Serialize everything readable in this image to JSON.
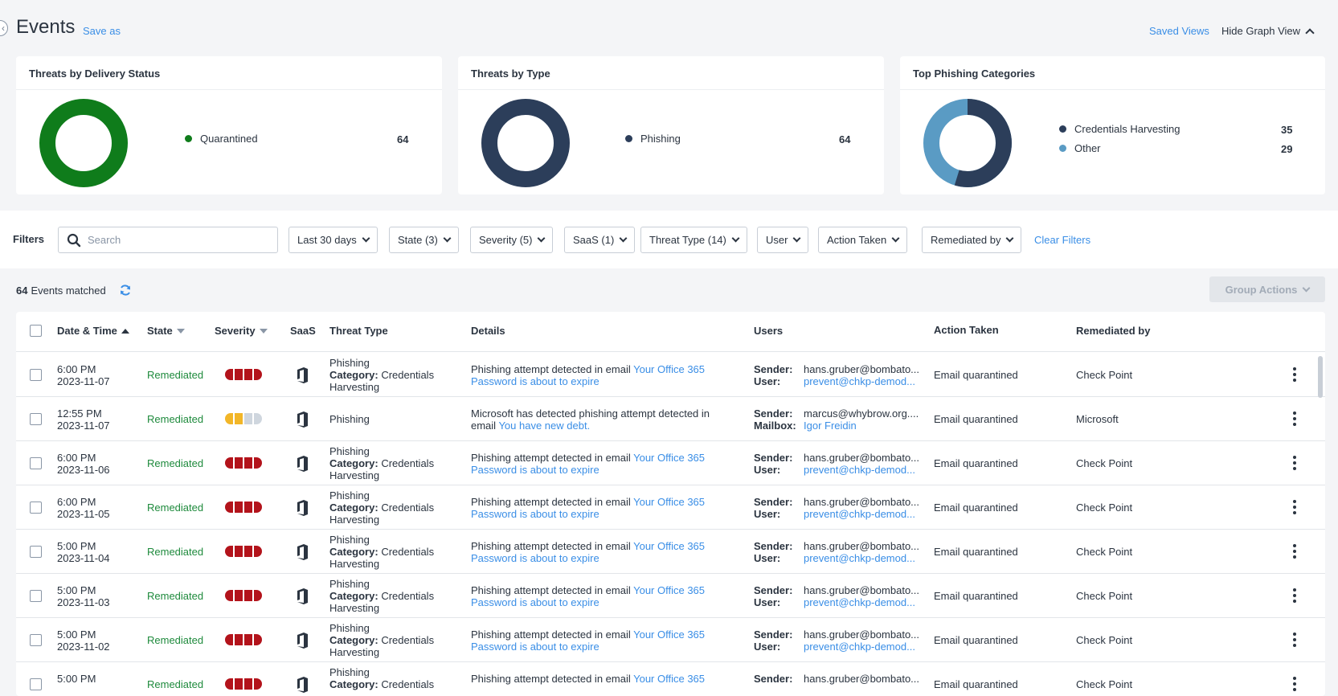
{
  "header": {
    "title": "Events",
    "save_as": "Save as",
    "saved_views": "Saved Views",
    "hide_graph": "Hide Graph View"
  },
  "cards": [
    {
      "title": "Threats by Delivery Status",
      "legend": [
        {
          "label": "Quarantined",
          "value": "64",
          "color": "#0f7c1b"
        }
      ]
    },
    {
      "title": "Threats by Type",
      "legend": [
        {
          "label": "Phishing",
          "value": "64",
          "color": "#2c3e5a"
        }
      ]
    },
    {
      "title": "Top Phishing Categories",
      "legend": [
        {
          "label": "Credentials Harvesting",
          "value": "35",
          "color": "#2c3e5a"
        },
        {
          "label": "Other",
          "value": "29",
          "color": "#5a9bc4"
        }
      ]
    }
  ],
  "chart_data": [
    {
      "type": "pie",
      "title": "Threats by Delivery Status",
      "categories": [
        "Quarantined"
      ],
      "values": [
        64
      ]
    },
    {
      "type": "pie",
      "title": "Threats by Type",
      "categories": [
        "Phishing"
      ],
      "values": [
        64
      ]
    },
    {
      "type": "pie",
      "title": "Top Phishing Categories",
      "categories": [
        "Credentials Harvesting",
        "Other"
      ],
      "values": [
        35,
        29
      ]
    }
  ],
  "filters": {
    "label": "Filters",
    "search_placeholder": "Search",
    "items": [
      "Last 30 days",
      "State (3)",
      "Severity (5)",
      "SaaS (1)",
      "Threat Type (14)",
      "User",
      "Action Taken",
      "Remediated by"
    ],
    "clear": "Clear Filters"
  },
  "summary": {
    "count": "64",
    "label": "Events matched",
    "group_actions": "Group Actions"
  },
  "table": {
    "headers": [
      "Date & Time",
      "State",
      "Severity",
      "SaaS",
      "Threat Type",
      "Details",
      "Users",
      "Action Taken",
      "Remediated by"
    ],
    "category_label": "Category:",
    "sender_label": "Sender:",
    "user_label": "User:",
    "mailbox_label": "Mailbox:",
    "rows": [
      {
        "time": "6:00 PM",
        "date": "2023-11-07",
        "state": "Remediated",
        "sev": "red",
        "threat": "Phishing",
        "category": "Credentials",
        "category2": "Harvesting",
        "detail_text": "Phishing attempt detected in email ",
        "detail_link": "Your Office 365",
        "detail_link2": "Password is about to expire",
        "sender": "hans.gruber@bombato...",
        "user_kind": "User:",
        "user": "prevent@chkp-demod...",
        "action": "Email quarantined",
        "remediated_by": "Check Point"
      },
      {
        "time": "12:55 PM",
        "date": "2023-11-07",
        "state": "Remediated",
        "sev": "yellow",
        "threat": "Phishing",
        "category": "",
        "category2": "",
        "detail_text": "Microsoft has detected phishing attempt detected in",
        "detail_text2": "email ",
        "detail_link": "You have new debt.",
        "detail_link2": "",
        "sender": "marcus@whybrow.org....",
        "user_kind": "Mailbox:",
        "user": "Igor Freidin",
        "action": "Email quarantined",
        "remediated_by": "Microsoft"
      },
      {
        "time": "6:00 PM",
        "date": "2023-11-06",
        "state": "Remediated",
        "sev": "red",
        "threat": "Phishing",
        "category": "Credentials",
        "category2": "Harvesting",
        "detail_text": "Phishing attempt detected in email ",
        "detail_link": "Your Office 365",
        "detail_link2": "Password is about to expire",
        "sender": "hans.gruber@bombato...",
        "user_kind": "User:",
        "user": "prevent@chkp-demod...",
        "action": "Email quarantined",
        "remediated_by": "Check Point"
      },
      {
        "time": "6:00 PM",
        "date": "2023-11-05",
        "state": "Remediated",
        "sev": "red",
        "threat": "Phishing",
        "category": "Credentials",
        "category2": "Harvesting",
        "detail_text": "Phishing attempt detected in email ",
        "detail_link": "Your Office 365",
        "detail_link2": "Password is about to expire",
        "sender": "hans.gruber@bombato...",
        "user_kind": "User:",
        "user": "prevent@chkp-demod...",
        "action": "Email quarantined",
        "remediated_by": "Check Point"
      },
      {
        "time": "5:00 PM",
        "date": "2023-11-04",
        "state": "Remediated",
        "sev": "red",
        "threat": "Phishing",
        "category": "Credentials",
        "category2": "Harvesting",
        "detail_text": "Phishing attempt detected in email ",
        "detail_link": "Your Office 365",
        "detail_link2": "Password is about to expire",
        "sender": "hans.gruber@bombato...",
        "user_kind": "User:",
        "user": "prevent@chkp-demod...",
        "action": "Email quarantined",
        "remediated_by": "Check Point"
      },
      {
        "time": "5:00 PM",
        "date": "2023-11-03",
        "state": "Remediated",
        "sev": "red",
        "threat": "Phishing",
        "category": "Credentials",
        "category2": "Harvesting",
        "detail_text": "Phishing attempt detected in email ",
        "detail_link": "Your Office 365",
        "detail_link2": "Password is about to expire",
        "sender": "hans.gruber@bombato...",
        "user_kind": "User:",
        "user": "prevent@chkp-demod...",
        "action": "Email quarantined",
        "remediated_by": "Check Point"
      },
      {
        "time": "5:00 PM",
        "date": "2023-11-02",
        "state": "Remediated",
        "sev": "red",
        "threat": "Phishing",
        "category": "Credentials",
        "category2": "Harvesting",
        "detail_text": "Phishing attempt detected in email ",
        "detail_link": "Your Office 365",
        "detail_link2": "Password is about to expire",
        "sender": "hans.gruber@bombato...",
        "user_kind": "User:",
        "user": "prevent@chkp-demod...",
        "action": "Email quarantined",
        "remediated_by": "Check Point"
      },
      {
        "time": "5:00 PM",
        "date": "",
        "state": "Remediated",
        "sev": "red",
        "threat": "Phishing",
        "category": "Credentials",
        "category2": "",
        "detail_text": "Phishing attempt detected in email ",
        "detail_link": "Your Office 365",
        "detail_link2": "",
        "sender": "hans.gruber@bombato...",
        "user_kind": "",
        "user": "",
        "action": "Email quarantined",
        "remediated_by": "Check Point"
      }
    ]
  },
  "colors": {
    "red": "#b3131b",
    "yellow": "#f2b628",
    "grey": "#cfd6de",
    "accent": "#3a8ee6",
    "green": "#1e8a3c"
  }
}
